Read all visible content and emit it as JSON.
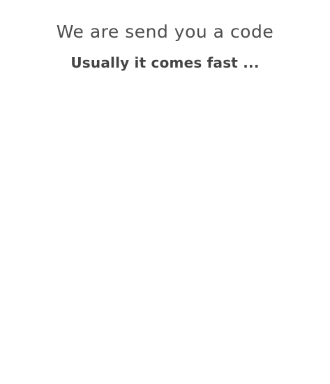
{
  "screen": {
    "title": "We are send you a code",
    "subtitle": "Usually it comes fast ..."
  },
  "colors": {
    "background": "#ffffff",
    "title_text": "#4d4d4d",
    "subtitle_text": "#444444"
  }
}
